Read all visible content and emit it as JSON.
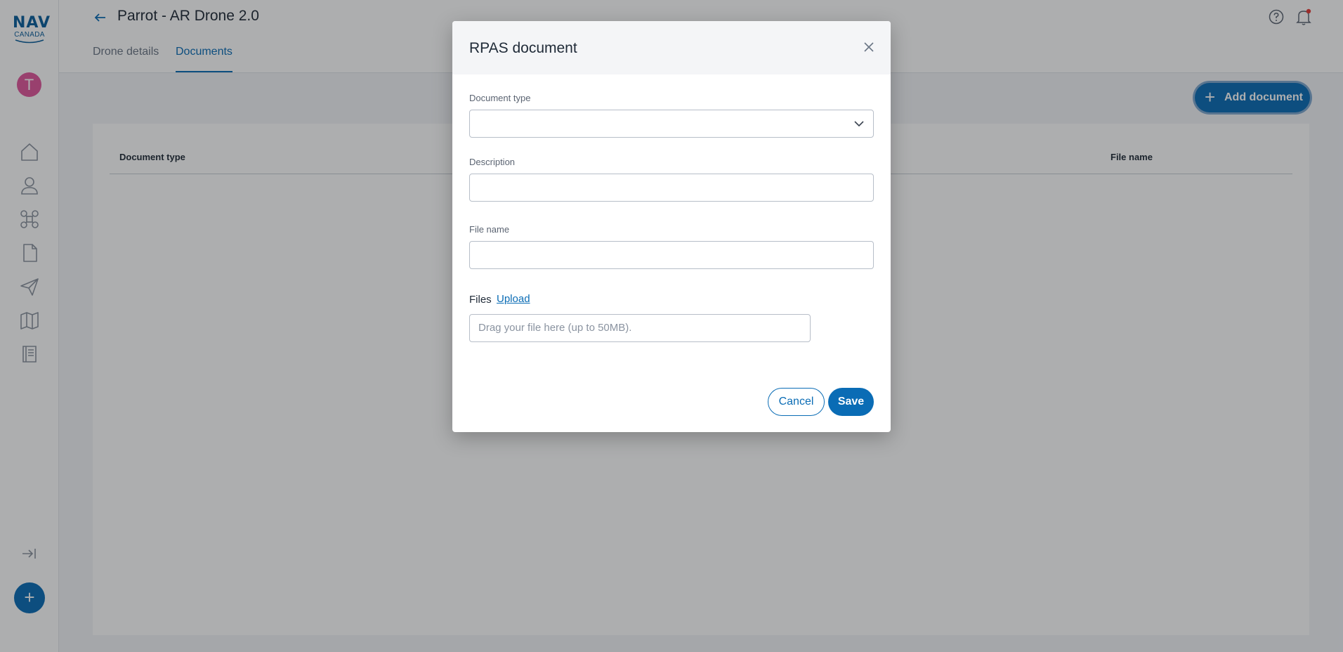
{
  "brand": {
    "name": "NAV",
    "sub": "CANADA"
  },
  "user": {
    "initial": "T"
  },
  "header": {
    "title": "Parrot - AR Drone 2.0",
    "tabs": [
      {
        "label": "Drone details",
        "active": false
      },
      {
        "label": "Documents",
        "active": true
      }
    ]
  },
  "toolbar": {
    "add_document": "Add document"
  },
  "table": {
    "columns": [
      "Document type",
      "File name"
    ]
  },
  "sidebar": {
    "icons": [
      "home-icon",
      "user-icon",
      "drone-icon",
      "document-icon",
      "send-icon",
      "map-icon",
      "book-icon"
    ],
    "collapse": "collapse-icon",
    "fab": "+"
  },
  "modal": {
    "title": "RPAS document",
    "fields": {
      "document_type": {
        "label": "Document type",
        "value": ""
      },
      "description": {
        "label": "Description",
        "value": ""
      },
      "file_name": {
        "label": "File name",
        "value": ""
      }
    },
    "files": {
      "label": "Files",
      "upload": "Upload",
      "placeholder": "Drag your file here (up to 50MB)."
    },
    "cancel": "Cancel",
    "save": "Save"
  },
  "colors": {
    "accent": "#0a6cb5",
    "avatar": "#e0569b",
    "notification": "#e53935"
  }
}
